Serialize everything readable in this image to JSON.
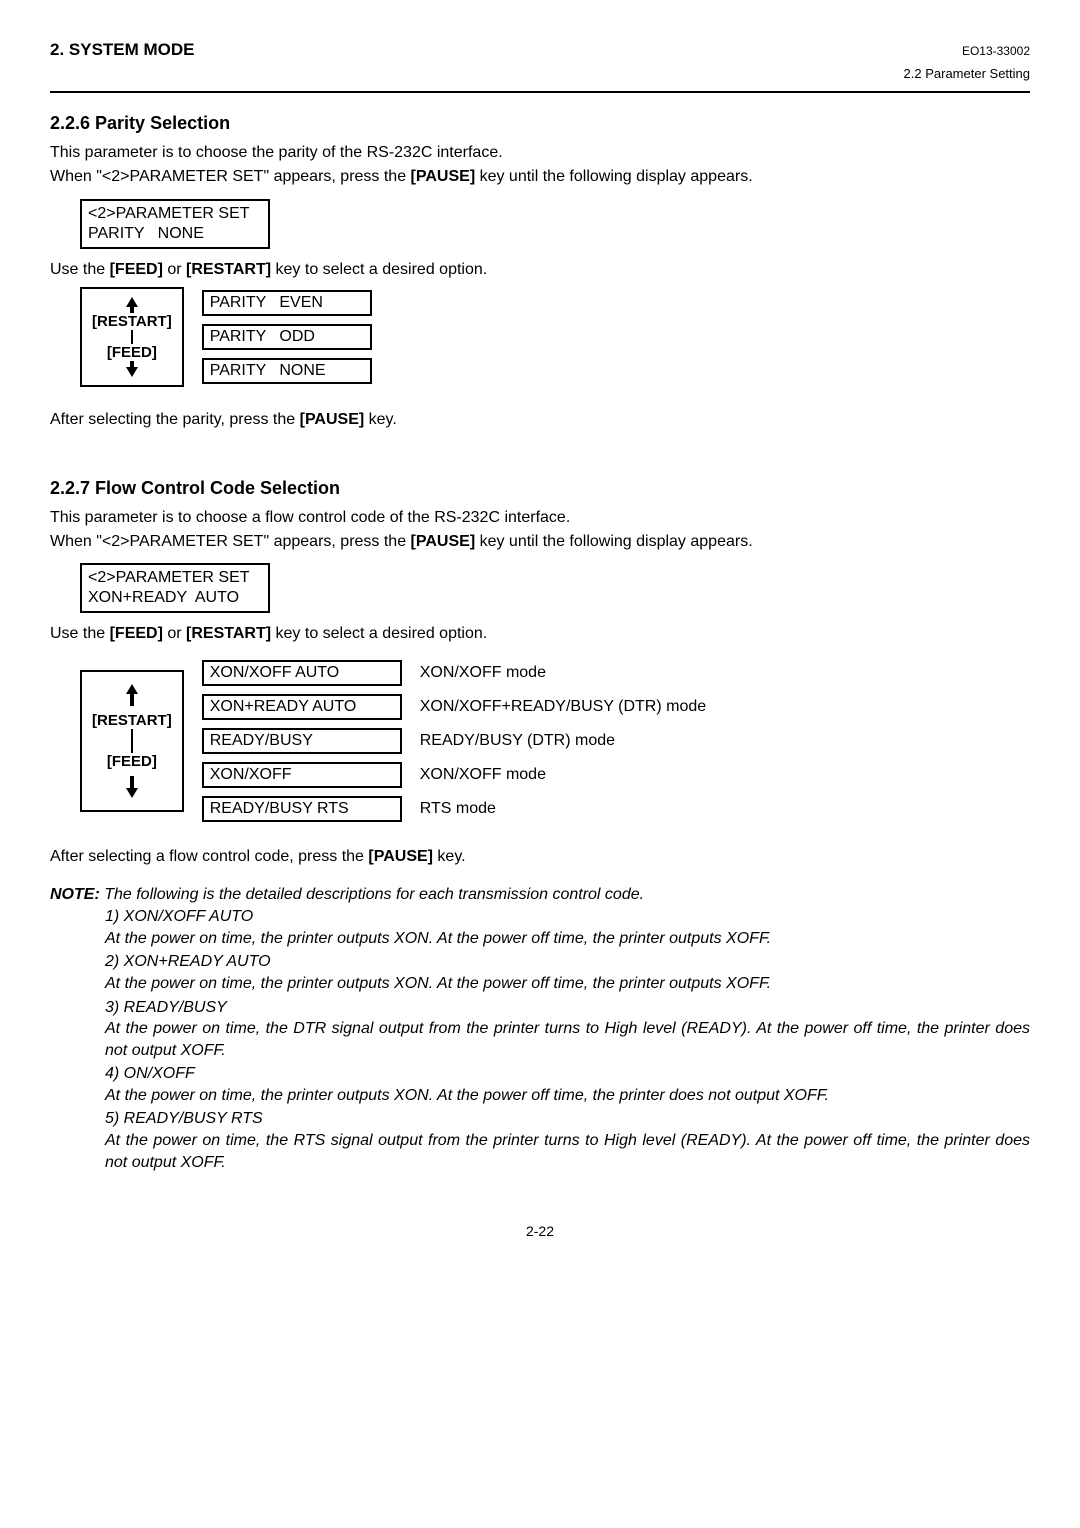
{
  "header": {
    "left": "2. SYSTEM MODE",
    "docnum": "EO13-33002",
    "sub": "2.2 Parameter Setting"
  },
  "s1": {
    "title": "2.2.6  Parity Selection",
    "p1": "This parameter is to choose the parity of the RS-232C interface.",
    "p2a": "When \"<2>PARAMETER SET\" appears, press the ",
    "p2b": "[PAUSE]",
    "p2c": " key until the following display appears.",
    "lcd1_l1": "<2>PARAMETER SET",
    "lcd1_l2": "PARITY   NONE",
    "p3a": "Use the ",
    "p3b": "[FEED]",
    "p3c": " or ",
    "p3d": "[RESTART]",
    "p3e": " key to select a desired option.",
    "nav_restart": "[RESTART]",
    "nav_feed": "[FEED]",
    "opt1": "PARITY   EVEN",
    "opt2": "PARITY   ODD",
    "opt3": "PARITY   NONE",
    "p4a": "After selecting the parity, press the ",
    "p4b": "[PAUSE]",
    "p4c": " key."
  },
  "s2": {
    "title": "2.2.7  Flow Control Code Selection",
    "p1": "This parameter is to choose a flow control code of the RS-232C interface.",
    "p2a": "When \"<2>PARAMETER SET\" appears, press the ",
    "p2b": "[PAUSE]",
    "p2c": " key until the following display appears.",
    "lcd1_l1": "<2>PARAMETER SET",
    "lcd1_l2": "XON+READY  AUTO",
    "p3a": "Use the ",
    "p3b": "[FEED]",
    "p3c": " or ",
    "p3d": "[RESTART]",
    "p3e": " key to select a desired option.",
    "nav_restart": "[RESTART]",
    "nav_feed": "[FEED]",
    "opts": [
      {
        "lcd": "XON/XOFF AUTO",
        "desc": "XON/XOFF mode"
      },
      {
        "lcd": "XON+READY AUTO",
        "desc": "XON/XOFF+READY/BUSY (DTR) mode"
      },
      {
        "lcd": "READY/BUSY",
        "desc": "READY/BUSY (DTR) mode"
      },
      {
        "lcd": "XON/XOFF",
        "desc": "XON/XOFF mode"
      },
      {
        "lcd": "READY/BUSY RTS",
        "desc": "RTS mode"
      }
    ],
    "p4a": "After selecting a flow control code, press the ",
    "p4b": "[PAUSE]",
    "p4c": " key."
  },
  "note": {
    "label": "NOTE:  ",
    "lead": "The following is the detailed descriptions for each transmission control code.",
    "items": [
      {
        "n": "1) ",
        "t": "XON/XOFF AUTO",
        "b": "At the power on time, the printer outputs XON.  At the power off time, the printer outputs XOFF."
      },
      {
        "n": "2) ",
        "t": "XON+READY AUTO",
        "b": "At the power on time, the printer outputs XON.  At the power off time, the printer outputs XOFF."
      },
      {
        "n": "3)  ",
        "t": "READY/BUSY",
        "b": "At the power on time, the DTR signal output from the printer turns to High level (READY).  At the power off time, the printer does not output XOFF."
      },
      {
        "n": "4) ",
        "t": "ON/XOFF",
        "b": "At the power on time, the printer outputs XON.  At the power off time, the printer does not output XOFF."
      },
      {
        "n": "5) ",
        "t": "READY/BUSY RTS",
        "b": "At the power on time, the RTS signal output from the printer turns to High level (READY). At the power off time, the printer does not output XOFF."
      }
    ]
  },
  "pagenum": "2-22"
}
